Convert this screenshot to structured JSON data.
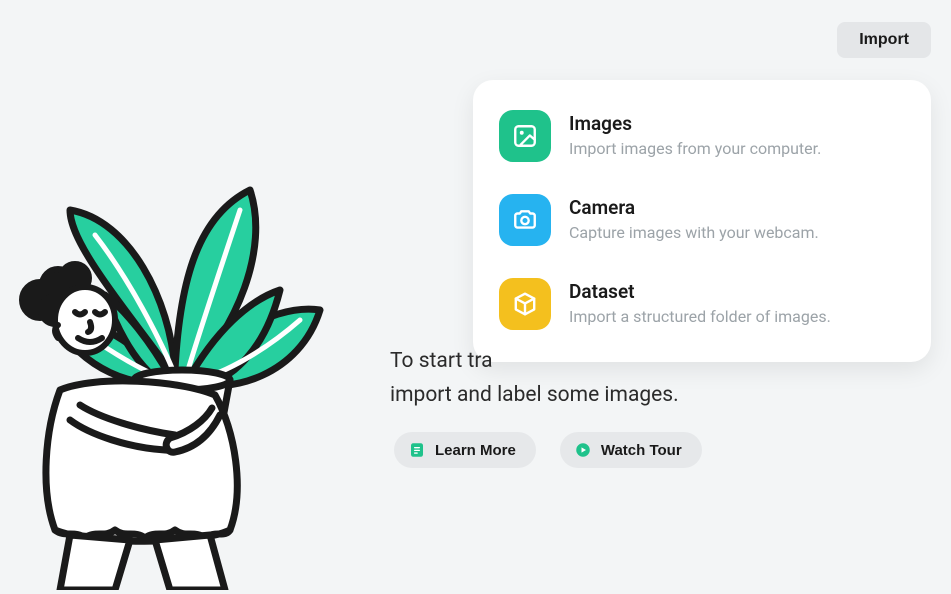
{
  "buttons": {
    "import": "Import",
    "learn_more": "Learn More",
    "watch_tour": "Watch Tour"
  },
  "dropdown": {
    "items": [
      {
        "title": "Images",
        "desc": "Import images from your computer.",
        "icon": "image-icon",
        "color": "green"
      },
      {
        "title": "Camera",
        "desc": "Capture images with your webcam.",
        "icon": "camera-icon",
        "color": "blue"
      },
      {
        "title": "Dataset",
        "desc": "Import a structured folder of images.",
        "icon": "cube-icon",
        "color": "yellow"
      }
    ]
  },
  "main": {
    "line1": "To start tra",
    "line2": "import and label some images."
  },
  "colors": {
    "accent_green": "#1fc28b",
    "accent_blue": "#26b3f0",
    "accent_yellow": "#f4c01e"
  }
}
